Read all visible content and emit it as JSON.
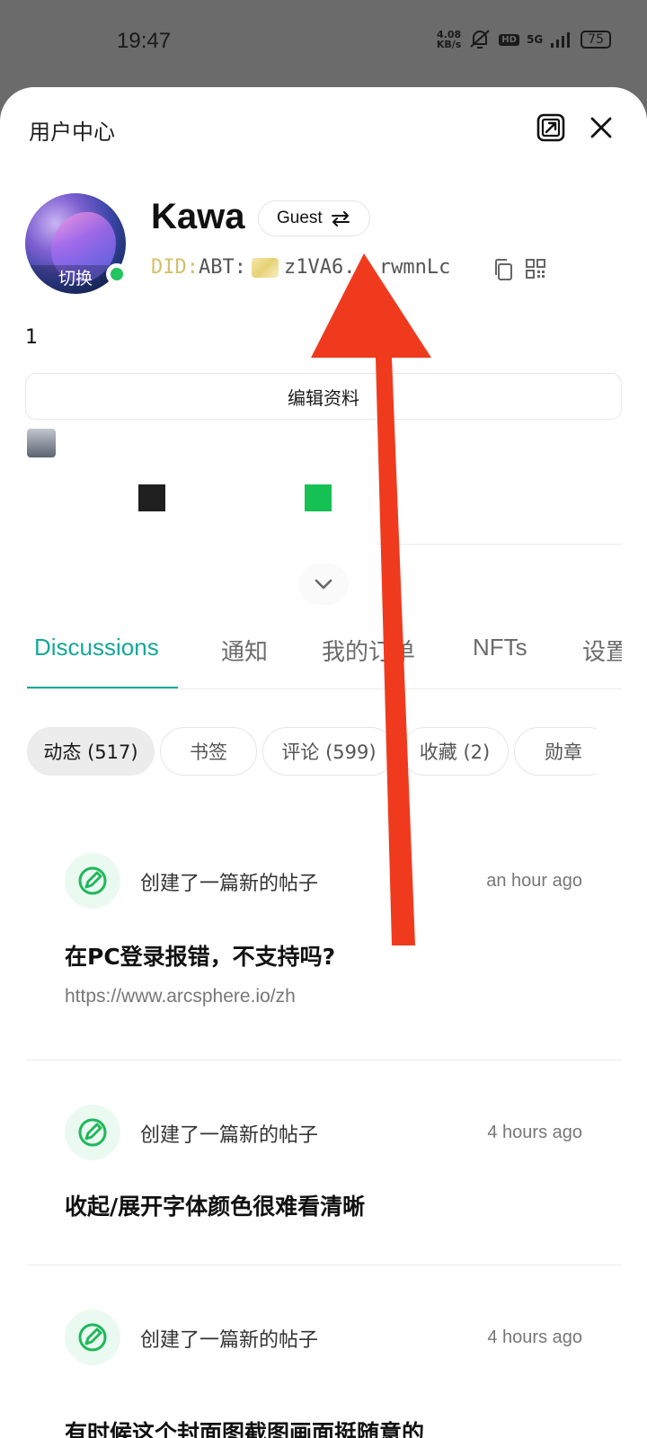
{
  "status_bar": {
    "time": "19:47",
    "net_speed_value": "4.08",
    "net_speed_unit": "KB/s",
    "hd_label": "HD",
    "network": "5G",
    "battery": "75"
  },
  "sheet": {
    "title": "用户中心"
  },
  "profile": {
    "avatar_switch_label": "切换",
    "username": "Kawa",
    "role_badge": "Guest",
    "did_prefix": "DID:",
    "did_scheme": "ABT:",
    "did_short": "z1VA6...rwmnLc",
    "bio": "1",
    "edit_button": "编辑资料",
    "swatch_colors": [
      "#1f1f1f",
      "#16c153"
    ]
  },
  "tabs": [
    {
      "label": "Discussions",
      "active": true
    },
    {
      "label": "通知",
      "active": false
    },
    {
      "label": "我的订单",
      "active": false
    },
    {
      "label": "NFTs",
      "active": false
    },
    {
      "label": "设置",
      "active": false
    }
  ],
  "filters": [
    {
      "label": "动态 (517)",
      "active": true
    },
    {
      "label": "书签",
      "active": false
    },
    {
      "label": "评论 (599)",
      "active": false
    },
    {
      "label": "收藏 (2)",
      "active": false
    },
    {
      "label": "勋章",
      "active": false
    }
  ],
  "feed": [
    {
      "action": "创建了一篇新的帖子",
      "time": "an hour ago",
      "title": "在PC登录报错，不支持吗?",
      "link": "https://www.arcsphere.io/zh"
    },
    {
      "action": "创建了一篇新的帖子",
      "time": "4 hours ago",
      "title": "收起/展开字体颜色很难看清晰",
      "link": ""
    },
    {
      "action": "创建了一篇新的帖子",
      "time": "4 hours ago",
      "title": "有时候这个封面图截图画面挺随意的",
      "link": ""
    }
  ],
  "colors": {
    "accent": "#14a89a",
    "annotation_arrow": "#f03a1e",
    "online": "#22c55e"
  }
}
